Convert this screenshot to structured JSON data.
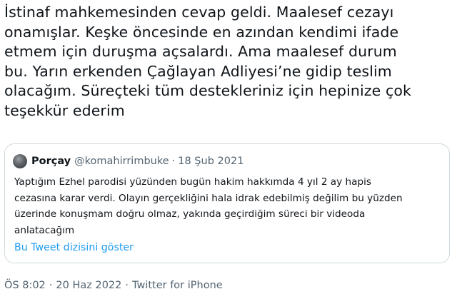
{
  "tweet": {
    "text": "İstinaf mahkemesinden cevap geldi. Maalesef cezayı\nonamışlar. Keşke öncesinde en azından kendimi ifade\netmem için duruşma açsalardı. Ama maalesef durum\nbu. Yarın erkenden Çağlayan Adliyesi’ne gidip teslim\nolacağım. Süreçteki tüm destekleriniz için hepinize çok\nteşekkür ederim"
  },
  "quote": {
    "name": "Porçay",
    "handle": "@komahirrimbuke",
    "dot": "·",
    "date": "18 Şub 2021",
    "text": "Yaptığım Ezhel parodisi yüzünden bugün hakim hakkımda 4 yıl 2 ay hapis\ncezasına karar verdi. Olayın gerçekliğini hala idrak edebilmiş değilim bu yüzden\nüzerinde konuşmam doğru olmaz, yakında geçirdiğim süreci bir videoda\nanlatacağım",
    "thread_link": "Bu Tweet dizisini göster"
  },
  "meta": {
    "time": "ÖS 8:02",
    "sep1": "·",
    "date": "20 Haz 2022",
    "sep2": "·",
    "source": "Twitter for iPhone"
  },
  "colors": {
    "text": "#0f1419",
    "secondary": "#536471",
    "link": "#1d9bf0",
    "border": "#cfd9de"
  }
}
